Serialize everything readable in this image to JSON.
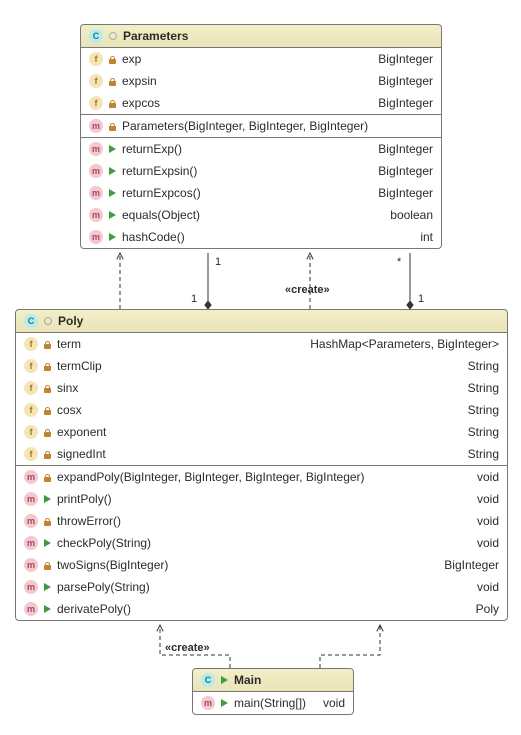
{
  "classes": {
    "parameters": {
      "name": "Parameters",
      "fields": [
        {
          "name": "exp",
          "type": "BigInteger"
        },
        {
          "name": "expsin",
          "type": "BigInteger"
        },
        {
          "name": "expcos",
          "type": "BigInteger"
        }
      ],
      "constructors": [
        {
          "sig": "Parameters(BigInteger, BigInteger, BigInteger)"
        }
      ],
      "methods": [
        {
          "sig": "returnExp()",
          "ret": "BigInteger"
        },
        {
          "sig": "returnExpsin()",
          "ret": "BigInteger"
        },
        {
          "sig": "returnExpcos()",
          "ret": "BigInteger"
        },
        {
          "sig": "equals(Object)",
          "ret": "boolean"
        },
        {
          "sig": "hashCode()",
          "ret": "int"
        }
      ]
    },
    "poly": {
      "name": "Poly",
      "fields": [
        {
          "name": "term",
          "type": "HashMap<Parameters, BigInteger>"
        },
        {
          "name": "termClip",
          "type": "String"
        },
        {
          "name": "sinx",
          "type": "String"
        },
        {
          "name": "cosx",
          "type": "String"
        },
        {
          "name": "exponent",
          "type": "String"
        },
        {
          "name": "signedInt",
          "type": "String"
        }
      ],
      "methods": [
        {
          "sig": "expandPoly(BigInteger, BigInteger, BigInteger, BigInteger)",
          "ret": "void"
        },
        {
          "sig": "printPoly()",
          "ret": "void"
        },
        {
          "sig": "throwError()",
          "ret": "void"
        },
        {
          "sig": "checkPoly(String)",
          "ret": "void"
        },
        {
          "sig": "twoSigns(BigInteger)",
          "ret": "BigInteger"
        },
        {
          "sig": "parsePoly(String)",
          "ret": "void"
        },
        {
          "sig": "derivatePoly()",
          "ret": "Poly"
        }
      ]
    },
    "main": {
      "name": "Main",
      "methods": [
        {
          "sig": "main(String[])",
          "ret": "void"
        }
      ]
    }
  },
  "relations": {
    "param_poly_left": {
      "mult_top": "1",
      "mult_bottom": "1"
    },
    "param_poly_right": {
      "mult_top": "*",
      "mult_bottom": "1"
    },
    "create1": "«create»",
    "create2": "«create»"
  }
}
